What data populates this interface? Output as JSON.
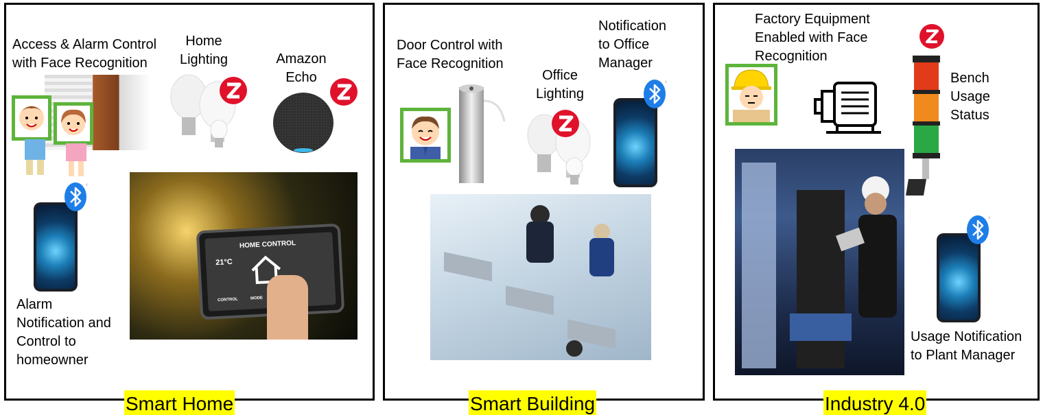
{
  "panels": {
    "smart_home": {
      "title": "Smart Home",
      "labels": {
        "access_1": "Access & Alarm Control",
        "access_2": "with Face Recognition",
        "lighting_1": "Home",
        "lighting_2": "Lighting",
        "echo_1": "Amazon",
        "echo_2": "Echo",
        "alarm_1": "Alarm",
        "alarm_2": "Notification and",
        "alarm_3": "Control to",
        "alarm_4": "homeowner"
      },
      "tablet": {
        "heading": "HOME CONTROL",
        "temperature": "21°C",
        "buttons": [
          "CONTROL",
          "MODE"
        ]
      }
    },
    "smart_building": {
      "title": "Smart Building",
      "labels": {
        "door_1": "Door Control with",
        "door_2": "Face Recognition",
        "office_lighting_1": "Office",
        "office_lighting_2": "Lighting",
        "notify_1": "Notification",
        "notify_2": "to Office",
        "notify_3": "Manager"
      }
    },
    "industry": {
      "title": "Industry 4.0",
      "labels": {
        "factory_1": "Factory Equipment",
        "factory_2": "Enabled with Face",
        "factory_3": "Recognition",
        "bench_1": "Bench",
        "bench_2": "Usage",
        "bench_3": "Status",
        "usage_1": "Usage Notification",
        "usage_2": "to Plant Manager"
      }
    }
  },
  "colors": {
    "title_highlight": "#ffff00",
    "face_frame": "#5db43b",
    "zwave_red": "#e0122b",
    "bluetooth_blue": "#1e7ee8"
  },
  "icons": [
    "bluetooth-icon",
    "zwave-icon",
    "motor-icon",
    "signal-tower-icon",
    "lightbulb-icon",
    "smartphone-icon"
  ]
}
